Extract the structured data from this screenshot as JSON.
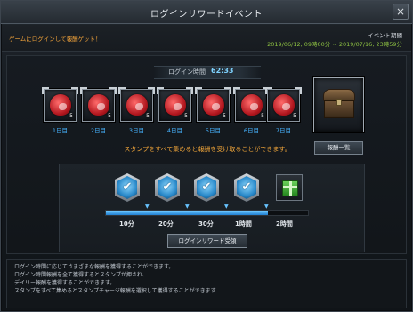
{
  "window": {
    "title": "ログインリワードイベント",
    "close_label": "×"
  },
  "header": {
    "subtitle": "ゲームにログインして報酬ゲット！",
    "period_label": "イベント期間",
    "period_dates": "2019/06/12, 09時00分 ~ 2019/07/16, 23時59分"
  },
  "login_time": {
    "label": "ログイン時間",
    "value": "62:33"
  },
  "stamps": [
    {
      "day": "1日目",
      "count": "5"
    },
    {
      "day": "2日目",
      "count": "5"
    },
    {
      "day": "3日目",
      "count": "5"
    },
    {
      "day": "4日目",
      "count": "5"
    },
    {
      "day": "5日目",
      "count": "5"
    },
    {
      "day": "6日目",
      "count": "5"
    },
    {
      "day": "7日目",
      "count": "5"
    }
  ],
  "reward_list_button": "報酬一覧",
  "notice": "スタンプをすべて集めると報酬を受け取ることができます。",
  "progress": {
    "fill_fraction": 0.8,
    "ticks": [
      "10分",
      "20分",
      "30分",
      "1時間",
      "2時間"
    ],
    "completed": 4
  },
  "claim_button": "ログインリワード受領",
  "description": [
    "ログイン時間に応じてさまざまな報酬を獲得することができます。",
    "ログイン時間報酬を全て獲得するとスタンプが押され、",
    "デイリー報酬を獲得することができます。",
    "スタンプをすべて集めるとスタンプチャージ報酬を選択して獲得することができます"
  ],
  "colors": {
    "accent": "#46b3ff",
    "notice": "#f2a63a",
    "dates": "#8fc342"
  },
  "icons": {
    "stamp": "heart-stamp-icon",
    "chest": "treasure-chest-icon",
    "check": "check-badge-icon",
    "gift": "gift-box-icon"
  }
}
